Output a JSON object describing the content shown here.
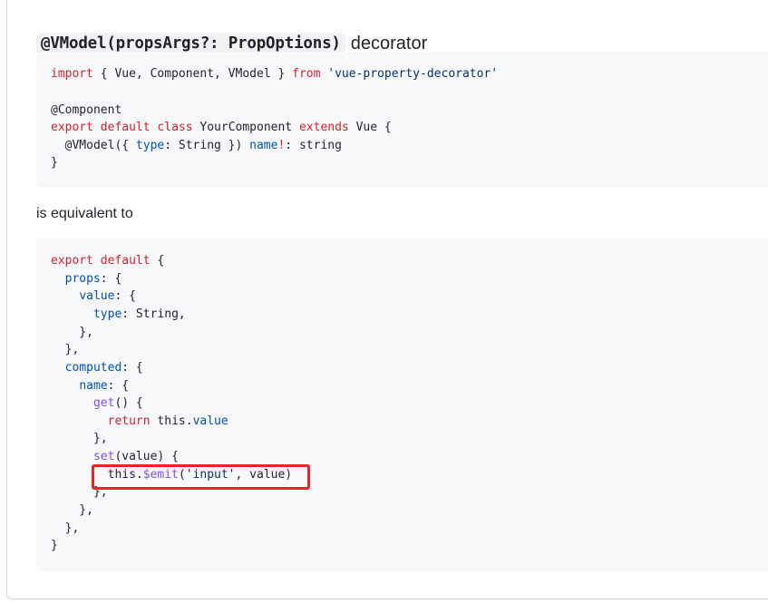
{
  "heading": {
    "code": "@VModel(propsArgs?: PropOptions)",
    "text": "decorator"
  },
  "code_block_1": {
    "lines": [
      "import { Vue, Component, VModel } from 'vue-property-decorator'",
      "",
      "@Component",
      "export default class YourComponent extends Vue {",
      "  @VModel({ type: String }) name!: string",
      "}"
    ]
  },
  "paragraph": "is equivalent to",
  "code_block_2": {
    "lines": [
      "export default {",
      "  props: {",
      "    value: {",
      "      type: String,",
      "    },",
      "  },",
      "  computed: {",
      "    name: {",
      "      get() {",
      "        return this.value",
      "      },",
      "      set(value) {",
      "        this.$emit('input', value)",
      "      },",
      "    },",
      "  },",
      "}"
    ],
    "highlighted_line": "this.$emit('input', value)"
  },
  "colors": {
    "keyword": "#cf222e",
    "string": "#0a3069",
    "property": "#0550ae",
    "function": "#8250df",
    "highlight_border": "#e8222a"
  }
}
